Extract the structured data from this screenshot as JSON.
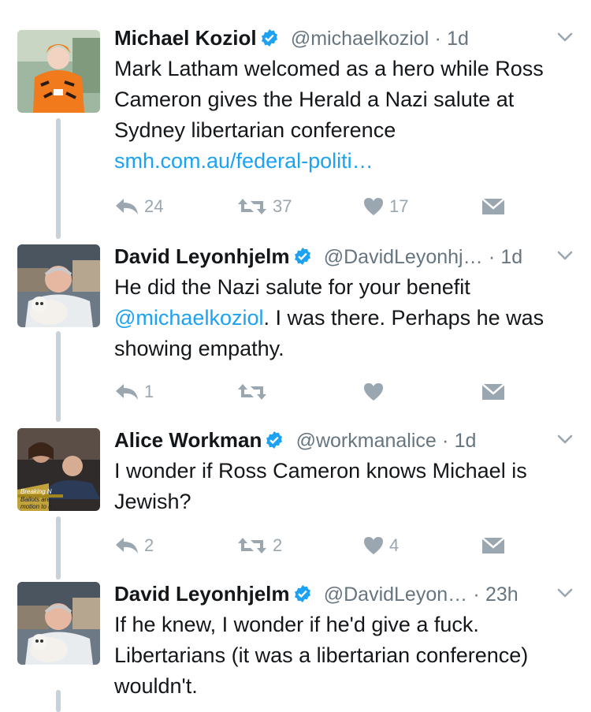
{
  "tweets": [
    {
      "name": "Michael Koziol",
      "handle": "@michaelkoziol",
      "time": "1d",
      "text": "Mark Latham welcomed as a hero while Ross Cameron gives the Herald a Nazi salute at Sydney libertarian conference",
      "link": "smh.com.au/federal-politi…",
      "replies": "24",
      "retweets": "37",
      "likes": "17"
    },
    {
      "name": "David Leyonhjelm",
      "handle": "@DavidLeyonhj…",
      "time": "1d",
      "text_before": "He did the Nazi salute for your benefit ",
      "mention": "@michaelkoziol",
      "text_after": ". I was there. Perhaps he was showing empathy.",
      "replies": "1",
      "retweets": "",
      "likes": ""
    },
    {
      "name": "Alice Workman",
      "handle": "@workmanalice",
      "time": "1d",
      "text": "I wonder if Ross Cameron knows Michael is Jewish?",
      "replies": "2",
      "retweets": "2",
      "likes": "4",
      "avatar_overlay": [
        "Breaking N",
        "Ballots are",
        "motion to n"
      ]
    },
    {
      "name": "David Leyonhjelm",
      "handle": "@DavidLeyon…",
      "time": "23h",
      "text": "If he knew, I wonder if he'd give a fuck. Libertarians (it was a libertarian conference) wouldn't."
    }
  ],
  "separator": "·",
  "colors": {
    "link": "#1da1f2",
    "verified": "#1da1f2",
    "muted": "#66757f",
    "action": "#9aa6b0",
    "thread": "#c8d0d8"
  },
  "icons": [
    "verified-badge-icon",
    "chevron-down-icon",
    "reply-icon",
    "retweet-icon",
    "heart-icon",
    "direct-message-icon"
  ]
}
